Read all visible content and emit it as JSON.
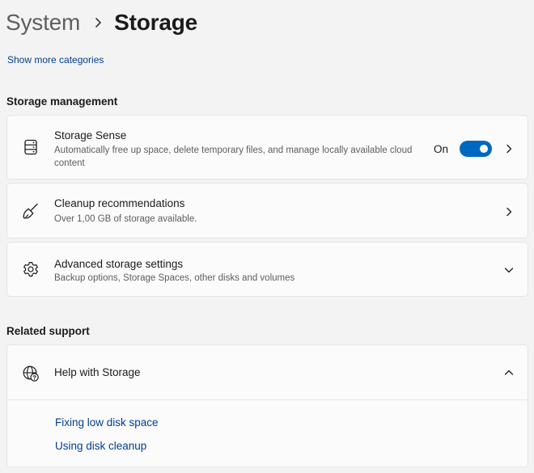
{
  "breadcrumb": {
    "parent": "System",
    "current": "Storage"
  },
  "show_more": "Show more categories",
  "storage_management": {
    "heading": "Storage management",
    "storage_sense": {
      "title": "Storage Sense",
      "description": "Automatically free up space, delete temporary files, and manage locally available cloud content",
      "toggle_label": "On",
      "toggle_on": true,
      "icon": "storage-drive-icon"
    },
    "cleanup": {
      "title": "Cleanup recommendations",
      "description": "Over 1,00 GB of storage available.",
      "icon": "broom-icon"
    },
    "advanced": {
      "title": "Advanced storage settings",
      "description": "Backup options, Storage Spaces, other disks and volumes",
      "icon": "gear-icon"
    }
  },
  "related_support": {
    "heading": "Related support",
    "help": {
      "title": "Help with Storage",
      "icon": "globe-help-icon",
      "links": [
        "Fixing low disk space",
        "Using disk cleanup"
      ]
    }
  },
  "colors": {
    "accent": "#0067c0",
    "link": "#003e92",
    "background": "#f3f3f3",
    "card": "#fbfbfb"
  }
}
